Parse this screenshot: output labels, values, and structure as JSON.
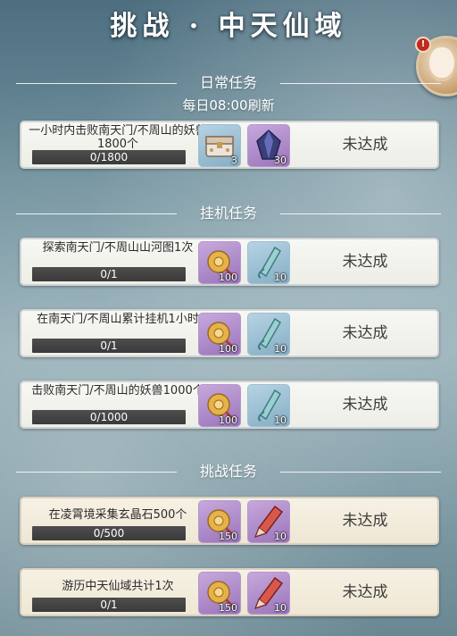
{
  "title": "挑战 · 中天仙域",
  "sections": {
    "daily": {
      "label": "日常任务",
      "refresh": "每日08:00刷新"
    },
    "idle": {
      "label": "挂机任务"
    },
    "challenge": {
      "label": "挑战任务"
    }
  },
  "tasks": [
    {
      "desc": "一小时内击败南天门/不周山的妖兽1800个",
      "progress": "0/1800",
      "fraction": 0,
      "rewards": [
        {
          "icon": "chest-icon",
          "qty": "3"
        },
        {
          "icon": "crystal-icon",
          "qty": "30"
        }
      ],
      "status": "未达成"
    },
    {
      "desc": "探索南天门/不周山山河图1次",
      "progress": "0/1",
      "fraction": 0,
      "rewards": [
        {
          "icon": "gold-coin-pouch-icon",
          "qty": "100"
        },
        {
          "icon": "jade-scroll-icon",
          "qty": "10"
        }
      ],
      "status": "未达成"
    },
    {
      "desc": "在南天门/不周山累计挂机1小时",
      "progress": "0/1",
      "fraction": 0,
      "rewards": [
        {
          "icon": "gold-coin-pouch-icon",
          "qty": "100"
        },
        {
          "icon": "jade-scroll-icon",
          "qty": "10"
        }
      ],
      "status": "未达成"
    },
    {
      "desc": "击败南天门/不周山的妖兽1000个",
      "progress": "0/1000",
      "fraction": 0,
      "rewards": [
        {
          "icon": "gold-coin-pouch-icon",
          "qty": "100"
        },
        {
          "icon": "jade-scroll-icon",
          "qty": "10"
        }
      ],
      "status": "未达成"
    },
    {
      "desc": "在凌霄境采集玄晶石500个",
      "progress": "0/500",
      "fraction": 0,
      "rewards": [
        {
          "icon": "gold-coin-pouch-icon",
          "qty": "150"
        },
        {
          "icon": "red-brush-icon",
          "qty": "10"
        }
      ],
      "status": "未达成"
    },
    {
      "desc": "游历中天仙域共计1次",
      "progress": "0/1",
      "fraction": 0,
      "rewards": [
        {
          "icon": "gold-coin-pouch-icon",
          "qty": "150"
        },
        {
          "icon": "red-brush-icon",
          "qty": "10"
        }
      ],
      "status": "未达成"
    }
  ],
  "alert_badge": "!"
}
